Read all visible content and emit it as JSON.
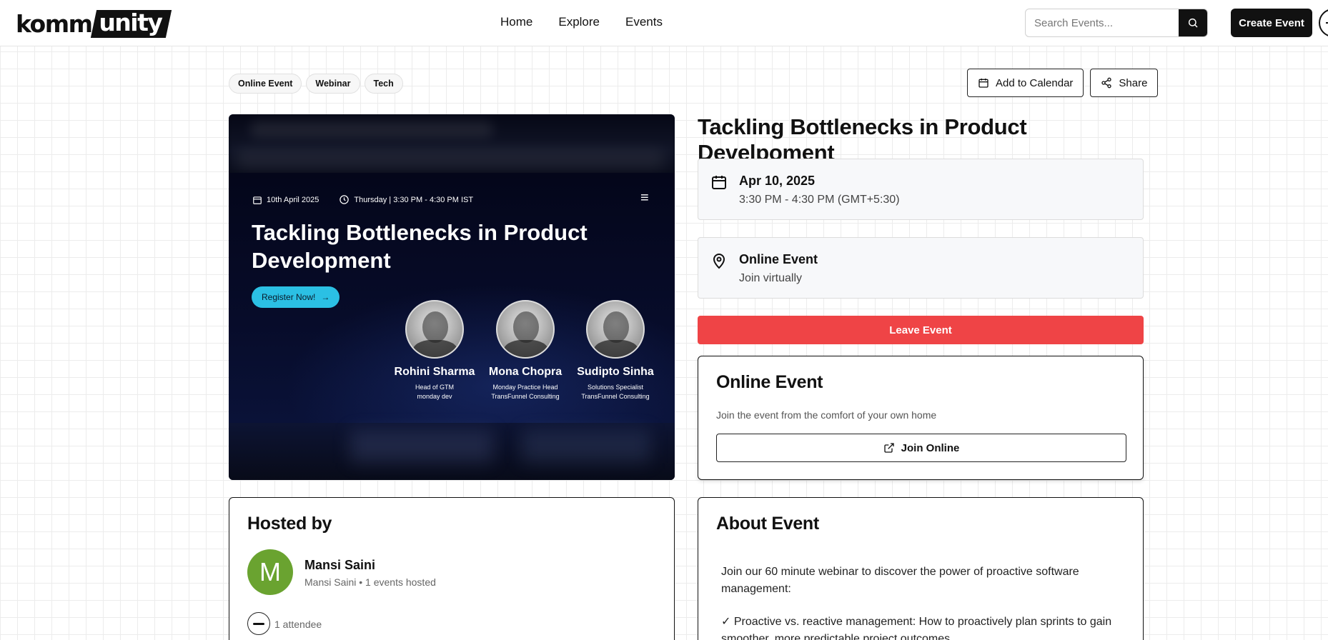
{
  "header": {
    "logo_left": "komm",
    "logo_right": "unity",
    "nav": [
      "Home",
      "Explore",
      "Events"
    ],
    "search_placeholder": "Search Events...",
    "create_label": "Create Event"
  },
  "tags": [
    "Online Event",
    "Webinar",
    "Tech"
  ],
  "actions": {
    "calendar_label": "Add to Calendar",
    "share_label": "Share"
  },
  "banner": {
    "date": "10th April 2025",
    "time": "Thursday | 3:30 PM - 4:30 PM IST",
    "title": "Tackling Bottlenecks in Product Development",
    "register_label": "Register Now!",
    "speakers": [
      {
        "name": "Rohini Sharma",
        "role_line1": "Head of GTM",
        "role_line2": "monday dev"
      },
      {
        "name": "Mona Chopra",
        "role_line1": "Monday Practice Head",
        "role_line2": "TransFunnel Consulting"
      },
      {
        "name": "Sudipto Sinha",
        "role_line1": "Solutions Specialist",
        "role_line2": "TransFunnel Consulting"
      }
    ]
  },
  "event": {
    "title": "Tackling Bottlenecks in Product Develpoment",
    "date": "Apr 10, 2025",
    "time": "3:30 PM - 4:30 PM (GMT+5:30)",
    "location_title": "Online Event",
    "location_sub": "Join virtually",
    "leave_label": "Leave Event"
  },
  "online_card": {
    "title": "Online Event",
    "description": "Join the event from the comfort of your own home",
    "join_label": "Join Online"
  },
  "host": {
    "heading": "Hosted by",
    "initial": "M",
    "name": "Mansi Saini",
    "sub": "Mansi Saini • 1 events hosted",
    "attendees": "1 attendee"
  },
  "about": {
    "heading": "About Event",
    "para1": "Join our 60 minute webinar to discover the power of proactive software management:",
    "para2": "✓ Proactive vs. reactive management: How to proactively plan sprints to gain smoother, more predictable project outcomes."
  },
  "colors": {
    "accent": "#111111",
    "danger": "#ef4446",
    "avatar": "#6aa330",
    "register": "#2bc0e4"
  }
}
